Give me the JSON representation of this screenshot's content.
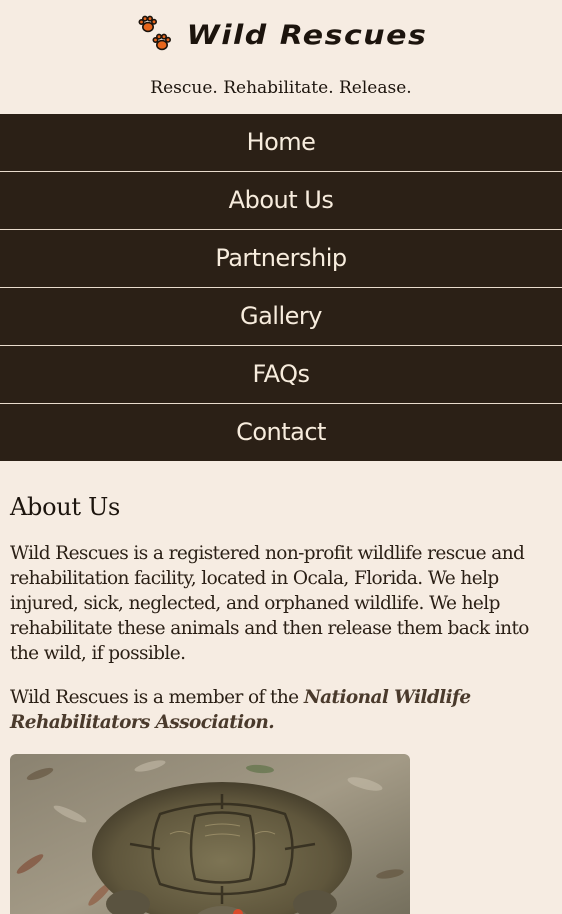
{
  "header": {
    "brand_name": "Wild Rescues",
    "tagline": "Rescue. Rehabilitate. Release.",
    "logo_icon": "paw-prints-icon"
  },
  "nav": {
    "items": [
      {
        "label": "Home"
      },
      {
        "label": "About Us"
      },
      {
        "label": "Partnership"
      },
      {
        "label": "Gallery"
      },
      {
        "label": "FAQs"
      },
      {
        "label": "Contact"
      }
    ]
  },
  "main": {
    "title": "About Us",
    "paragraph1": "Wild Rescues is a registered non-profit wildlife rescue and rehabilitation facility, located in Ocala, Florida. We help injured, sick, neglected, and orphaned wildlife. We help rehabilitate these animals and then release them back into the wild, if possible.",
    "paragraph2_prefix": "Wild Rescues is a member of the ",
    "paragraph2_emphasis": "National Wildlife Rehabilitators Association."
  },
  "colors": {
    "background": "#f6ece2",
    "nav_background": "#2b2016",
    "nav_text": "#f7ecdd",
    "paw_orange": "#e8661c"
  }
}
